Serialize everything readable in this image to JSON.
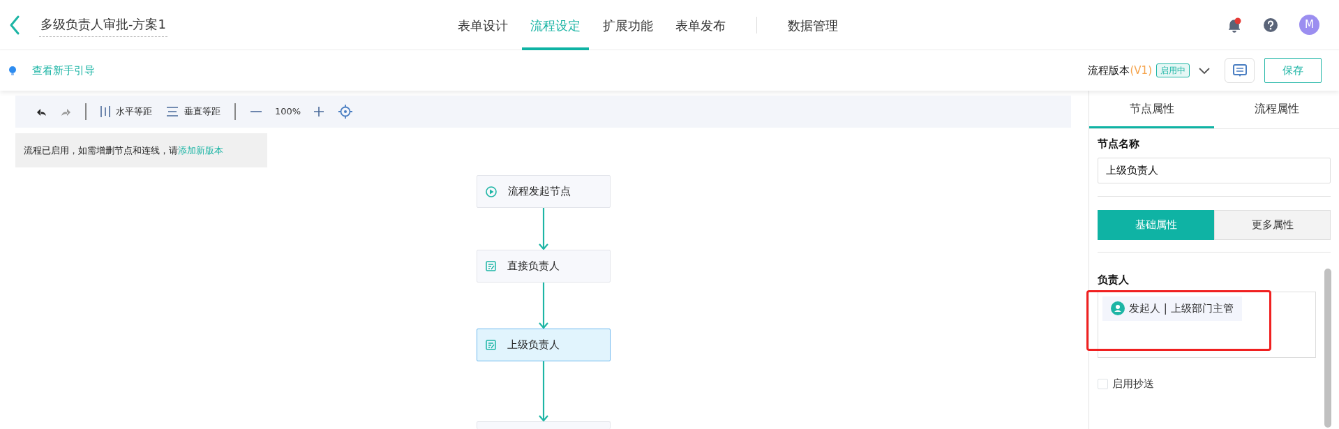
{
  "header": {
    "title": "多级负责人审批-方案1",
    "tabs": [
      {
        "label": "表单设计",
        "selected": false
      },
      {
        "label": "流程设定",
        "selected": true
      },
      {
        "label": "扩展功能",
        "selected": false
      },
      {
        "label": "表单发布",
        "selected": false
      },
      {
        "label": "数据管理",
        "selected": false
      }
    ],
    "notifications": {
      "unread": true
    },
    "avatar": "M"
  },
  "subbar": {
    "guide_link": "查看新手引导",
    "version_label": "流程版本",
    "version": "(V1)",
    "status": "启用中",
    "save": "保存"
  },
  "toolbar": {
    "undo_disabled": false,
    "redo_disabled": true,
    "h_distribute": "水平等距",
    "v_distribute": "垂直等距",
    "zoom": "100%"
  },
  "notice": {
    "text": "流程已启用，如需增删节点和连线，请",
    "link": "添加新版本"
  },
  "flow": {
    "nodes": [
      {
        "label": "流程发起节点",
        "kind": "start",
        "selected": false
      },
      {
        "label": "直接负责人",
        "kind": "approval",
        "selected": false
      },
      {
        "label": "上级负责人",
        "kind": "approval",
        "selected": true
      }
    ]
  },
  "panel": {
    "tabs": [
      {
        "label": "节点属性",
        "selected": true
      },
      {
        "label": "流程属性",
        "selected": false
      }
    ],
    "node_name_label": "节点名称",
    "node_name": "上级负责人",
    "segments": [
      {
        "label": "基础属性",
        "selected": true
      },
      {
        "label": "更多属性",
        "selected": false
      }
    ],
    "assignee_label": "负责人",
    "assignee": "发起人 | 上级部门主管",
    "cc": {
      "label": "启用抄送",
      "checked": false
    }
  }
}
